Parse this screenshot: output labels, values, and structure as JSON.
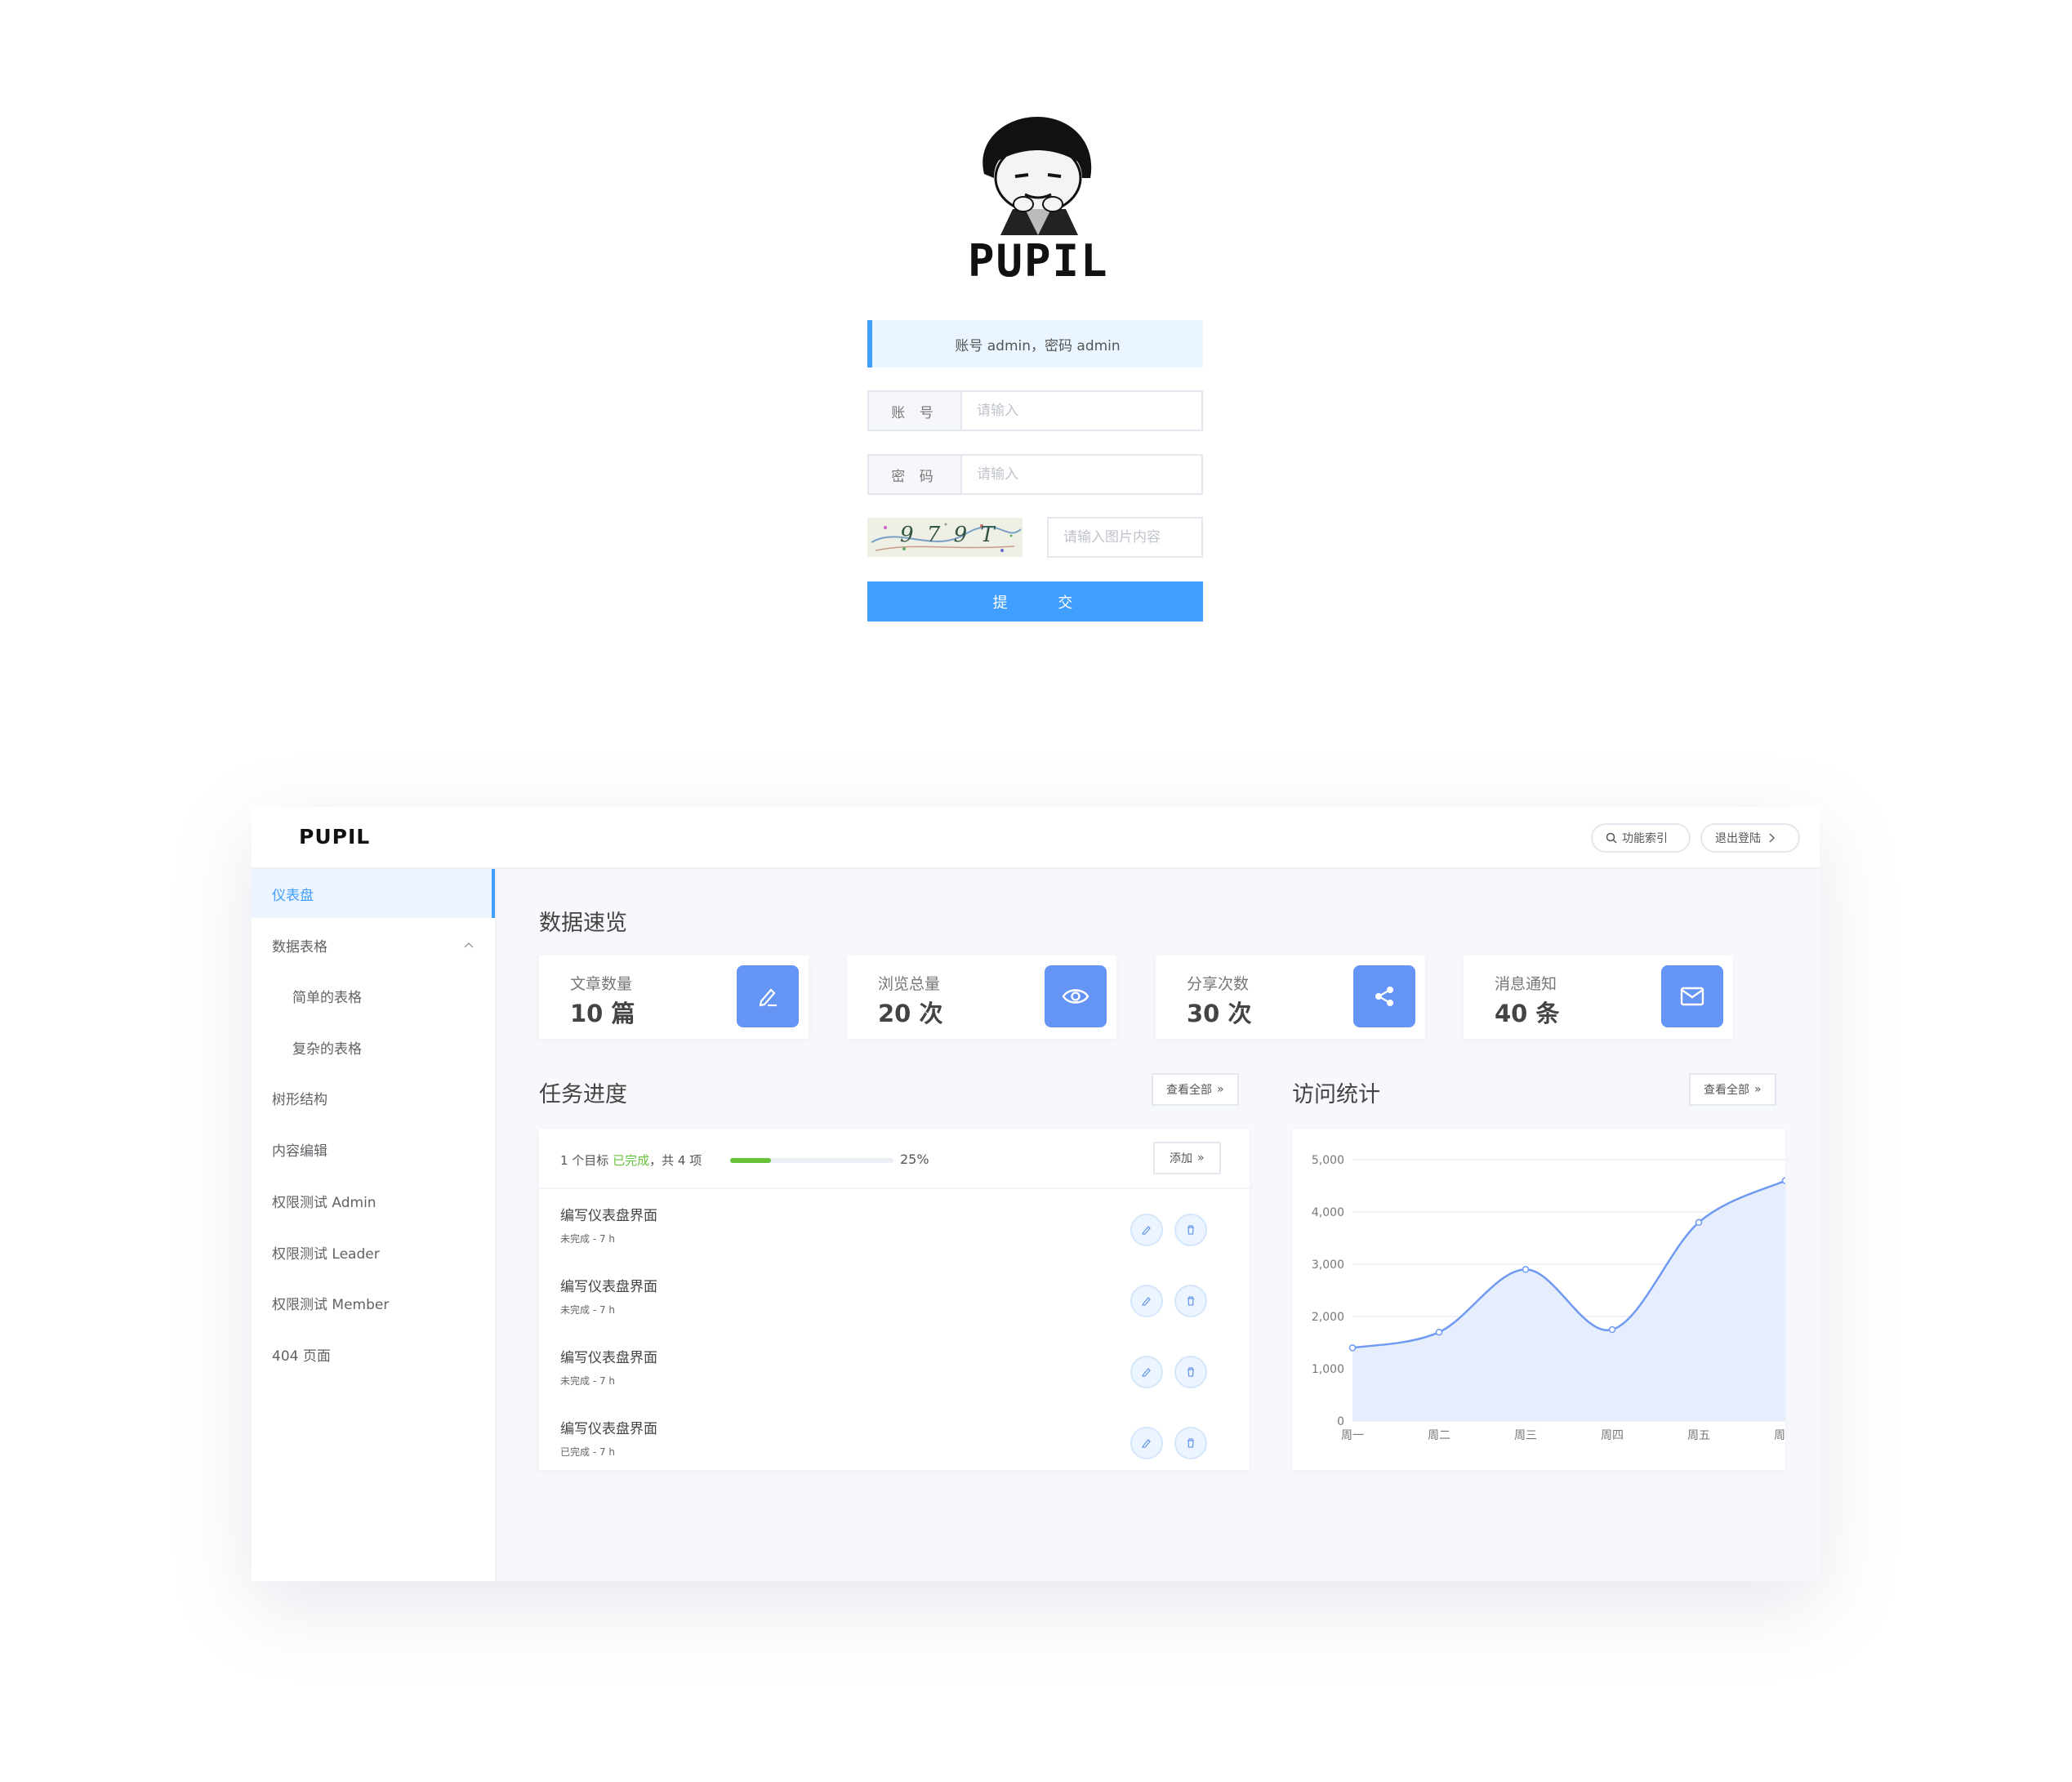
{
  "login": {
    "logo_text": "PUPIL",
    "tip": "账号 admin，密码 admin",
    "account_label": "账 号",
    "account_placeholder": "请输入",
    "password_label": "密 码",
    "password_placeholder": "请输入",
    "captcha_text": "9 7 9 T",
    "captcha_placeholder": "请输入图片内容",
    "submit_label": "提 交"
  },
  "header": {
    "brand": "PUPIL",
    "search_label": "功能索引",
    "logout_label": "退出登陆"
  },
  "sidebar": {
    "items": [
      {
        "label": "仪表盘"
      },
      {
        "label": "数据表格"
      },
      {
        "label": "简单的表格"
      },
      {
        "label": "复杂的表格"
      },
      {
        "label": "树形结构"
      },
      {
        "label": "内容编辑"
      },
      {
        "label": "权限测试 Admin"
      },
      {
        "label": "权限测试 Leader"
      },
      {
        "label": "权限测试 Member"
      },
      {
        "label": "404 页面"
      }
    ]
  },
  "overview": {
    "title": "数据速览",
    "cards": [
      {
        "title": "文章数量",
        "value": "10 篇",
        "icon": "edit-icon"
      },
      {
        "title": "浏览总量",
        "value": "20 次",
        "icon": "eye-icon"
      },
      {
        "title": "分享次数",
        "value": "30 次",
        "icon": "share-icon"
      },
      {
        "title": "消息通知",
        "value": "40 条",
        "icon": "mail-icon"
      }
    ]
  },
  "tasks": {
    "title": "任务进度",
    "view_all": "查看全部",
    "summary_prefix": "1 个目标",
    "summary_done": "已完成",
    "summary_suffix": "，共 4 项",
    "progress": 0.25,
    "progress_label": "25%",
    "add_label": "添加",
    "items": [
      {
        "name": "编写仪表盘界面",
        "status": "未完成 - 7 h"
      },
      {
        "name": "编写仪表盘界面",
        "status": "未完成 - 7 h"
      },
      {
        "name": "编写仪表盘界面",
        "status": "未完成 - 7 h"
      },
      {
        "name": "编写仪表盘界面",
        "status": "已完成 - 7 h"
      }
    ]
  },
  "visits": {
    "title": "访问统计",
    "view_all": "查看全部"
  },
  "colors": {
    "primary": "#409eff",
    "icon_bg": "#6495f5",
    "progress_green": "#67c23a",
    "line": "#6f9af1"
  },
  "chart_data": {
    "type": "area",
    "categories": [
      "周一",
      "周二",
      "周三",
      "周四",
      "周五",
      "周六"
    ],
    "values": [
      1400,
      1700,
      2900,
      1750,
      3800,
      4600
    ],
    "ylim": [
      0,
      5000
    ],
    "yticks": [
      "0",
      "1,000",
      "2,000",
      "3,000",
      "4,000",
      "5,000"
    ],
    "grid": true
  }
}
